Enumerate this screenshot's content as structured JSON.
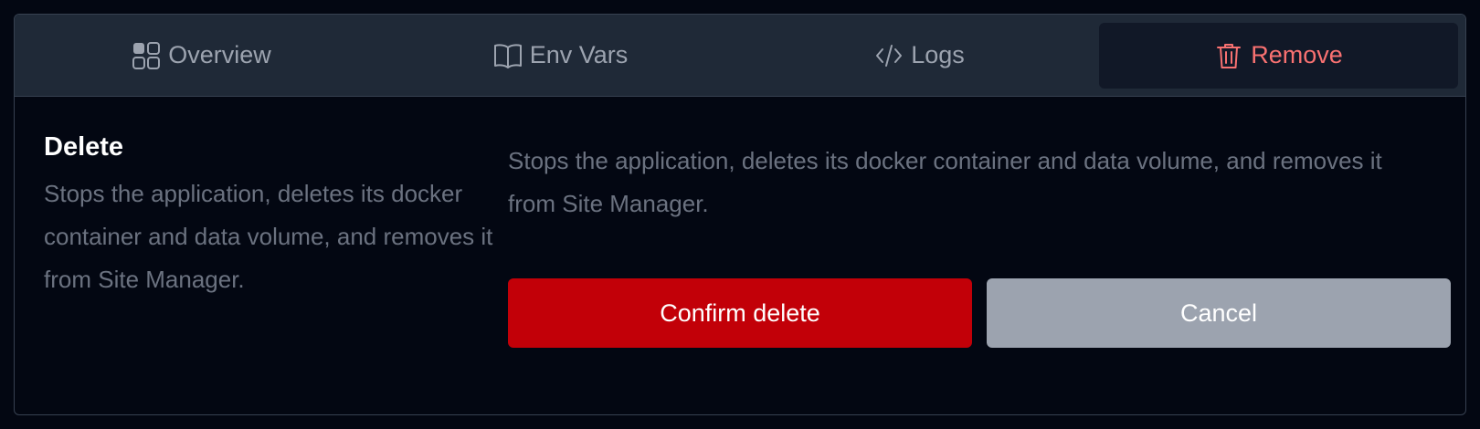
{
  "tabs": [
    {
      "label": "Overview",
      "icon": "grid-icon"
    },
    {
      "label": "Env Vars",
      "icon": "book-icon"
    },
    {
      "label": "Logs",
      "icon": "code-icon"
    },
    {
      "label": "Remove",
      "icon": "trash-icon",
      "active": true
    }
  ],
  "delete_section": {
    "title": "Delete",
    "description": "Stops the application, deletes its docker container and data volume, and removes it from Site Manager."
  },
  "confirm_panel": {
    "message": "Stops the application, deletes its docker container and data volume, and removes it from Site Manager.",
    "confirm_label": "Confirm delete",
    "cancel_label": "Cancel"
  },
  "colors": {
    "danger": "#c20008",
    "active_tab_text": "#f87171",
    "muted_text": "#6b7280"
  }
}
